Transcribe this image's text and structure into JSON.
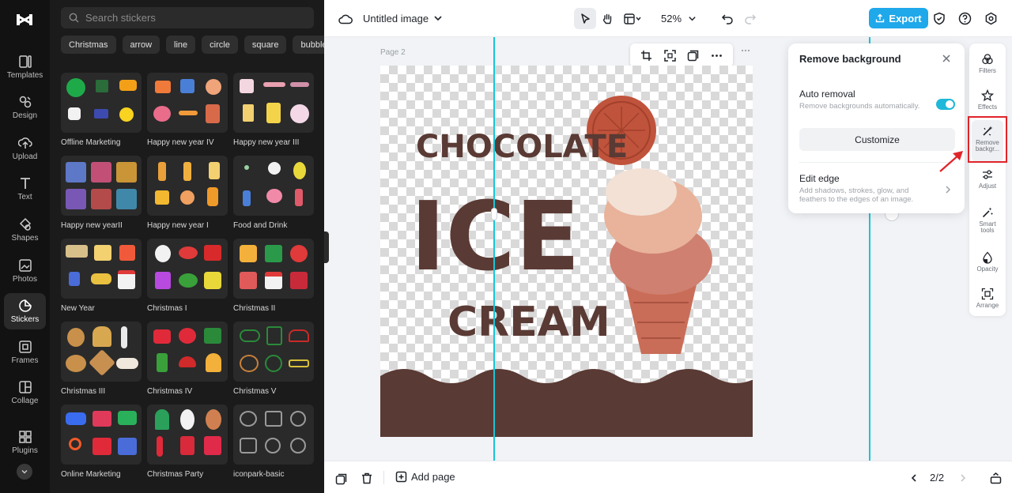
{
  "rail": {
    "items": [
      {
        "label": "Templates",
        "icon": "templates-icon"
      },
      {
        "label": "Design",
        "icon": "design-icon"
      },
      {
        "label": "Upload",
        "icon": "upload-icon"
      },
      {
        "label": "Text",
        "icon": "text-icon"
      },
      {
        "label": "Shapes",
        "icon": "shapes-icon"
      },
      {
        "label": "Photos",
        "icon": "photos-icon"
      },
      {
        "label": "Stickers",
        "icon": "stickers-icon",
        "active": true
      },
      {
        "label": "Frames",
        "icon": "frames-icon"
      },
      {
        "label": "Collage",
        "icon": "collage-icon"
      },
      {
        "label": "Plugins",
        "icon": "plugins-icon"
      }
    ]
  },
  "panel": {
    "search_placeholder": "Search stickers",
    "chips": [
      "Christmas",
      "arrow",
      "line",
      "circle",
      "square",
      "bubble"
    ],
    "cards": [
      "Offline Marketing",
      "Happy new year IV",
      "Happy new year III",
      "Happy new yearII",
      "Happy new year I",
      "Food and Drink",
      "New Year",
      "Christmas I",
      "Christmas II",
      "Christmas III",
      "Christmas IV",
      "Christmas V",
      "Online Marketing",
      "Christmas Party",
      "iconpark-basic"
    ]
  },
  "topbar": {
    "title": "Untitled image",
    "zoom": "52%",
    "export_label": "Export"
  },
  "canvas": {
    "page_label": "Page 2",
    "art_lines": [
      "CHOCOLATE",
      "ICE",
      "CREAM"
    ]
  },
  "popup": {
    "title": "Remove background",
    "auto_title": "Auto removal",
    "auto_desc": "Remove backgrounds automatically.",
    "customize_label": "Customize",
    "edge_title": "Edit edge",
    "edge_desc": "Add shadows, strokes, glow, and feathers to the edges of an image."
  },
  "right_tools": [
    {
      "label": "Filters"
    },
    {
      "label": "Effects"
    },
    {
      "label": "Remove backgr...",
      "active": true
    },
    {
      "label": "Adjust"
    },
    {
      "label": "Smart tools"
    },
    {
      "label": "Opacity"
    },
    {
      "label": "Arrange"
    }
  ],
  "bottombar": {
    "add_page": "Add page",
    "pager": "2/2"
  },
  "colors": {
    "accent": "#1fa8ea",
    "chocolate": "#5a3a34",
    "highlight": "#e0242a"
  }
}
